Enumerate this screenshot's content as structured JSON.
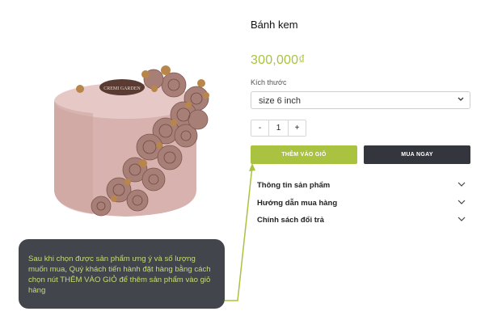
{
  "product": {
    "title": "Bánh kem",
    "price": "300,000₫",
    "image_name": "rose-buttercream-cake",
    "cake_label": "CREMI GARDEN"
  },
  "size": {
    "label": "Kích thước",
    "selected": "size 6 inch"
  },
  "quantity": {
    "minus": "-",
    "value": "1",
    "plus": "+"
  },
  "buttons": {
    "add_to_cart": "THÊM VÀO GIỎ",
    "buy_now": "MUA NGAY"
  },
  "accordion": [
    {
      "label": "Thông tin sản phẩm"
    },
    {
      "label": "Hướng dẫn mua hàng"
    },
    {
      "label": "Chính sách đổi trả"
    }
  ],
  "tooltip": {
    "text": "Sau khi chọn được sản phẩm ưng ý và số lượng muốn mua, Quý khách tiến hành đặt hàng bằng cách chọn nút THÊM VÀO GIỎ để thêm sản phẩm vào giỏ hàng"
  },
  "colors": {
    "accent": "#a9c23f",
    "dark": "#33363c",
    "tooltip_bg": "#42454b",
    "tooltip_text": "#c9db73"
  }
}
